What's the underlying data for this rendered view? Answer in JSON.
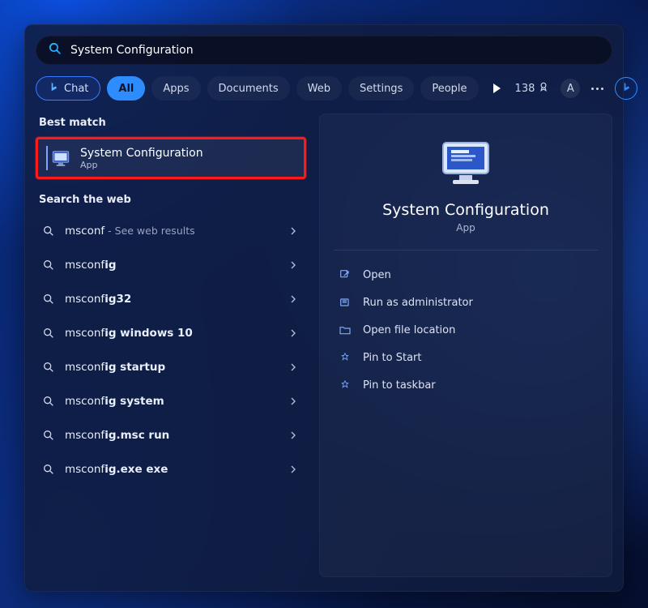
{
  "search": {
    "value": "System Configuration"
  },
  "filters": {
    "chat_label": "Chat",
    "all_label": "All",
    "apps_label": "Apps",
    "documents_label": "Documents",
    "web_label": "Web",
    "settings_label": "Settings",
    "people_label": "People"
  },
  "rewards_points": "138",
  "A_label": "A",
  "sections": {
    "best_match_header": "Best match",
    "search_web_header": "Search the web"
  },
  "best_match": {
    "title": "System Configuration",
    "subtitle": "App"
  },
  "web_results": [
    {
      "prefix": "msconf",
      "bold": "",
      "suffix": "",
      "hint": " - See web results"
    },
    {
      "prefix": "msconf",
      "bold": "ig",
      "suffix": "",
      "hint": ""
    },
    {
      "prefix": "msconf",
      "bold": "ig32",
      "suffix": "",
      "hint": ""
    },
    {
      "prefix": "msconf",
      "bold": "ig windows 10",
      "suffix": "",
      "hint": ""
    },
    {
      "prefix": "msconf",
      "bold": "ig startup",
      "suffix": "",
      "hint": ""
    },
    {
      "prefix": "msconf",
      "bold": "ig system",
      "suffix": "",
      "hint": ""
    },
    {
      "prefix": "msconf",
      "bold": "ig.msc run",
      "suffix": "",
      "hint": ""
    },
    {
      "prefix": "msconf",
      "bold": "ig.exe exe",
      "suffix": "",
      "hint": ""
    }
  ],
  "preview": {
    "title": "System Configuration",
    "subtitle": "App"
  },
  "actions": {
    "open": "Open",
    "run_admin": "Run as administrator",
    "open_file_location": "Open file location",
    "pin_start": "Pin to Start",
    "pin_taskbar": "Pin to taskbar"
  }
}
